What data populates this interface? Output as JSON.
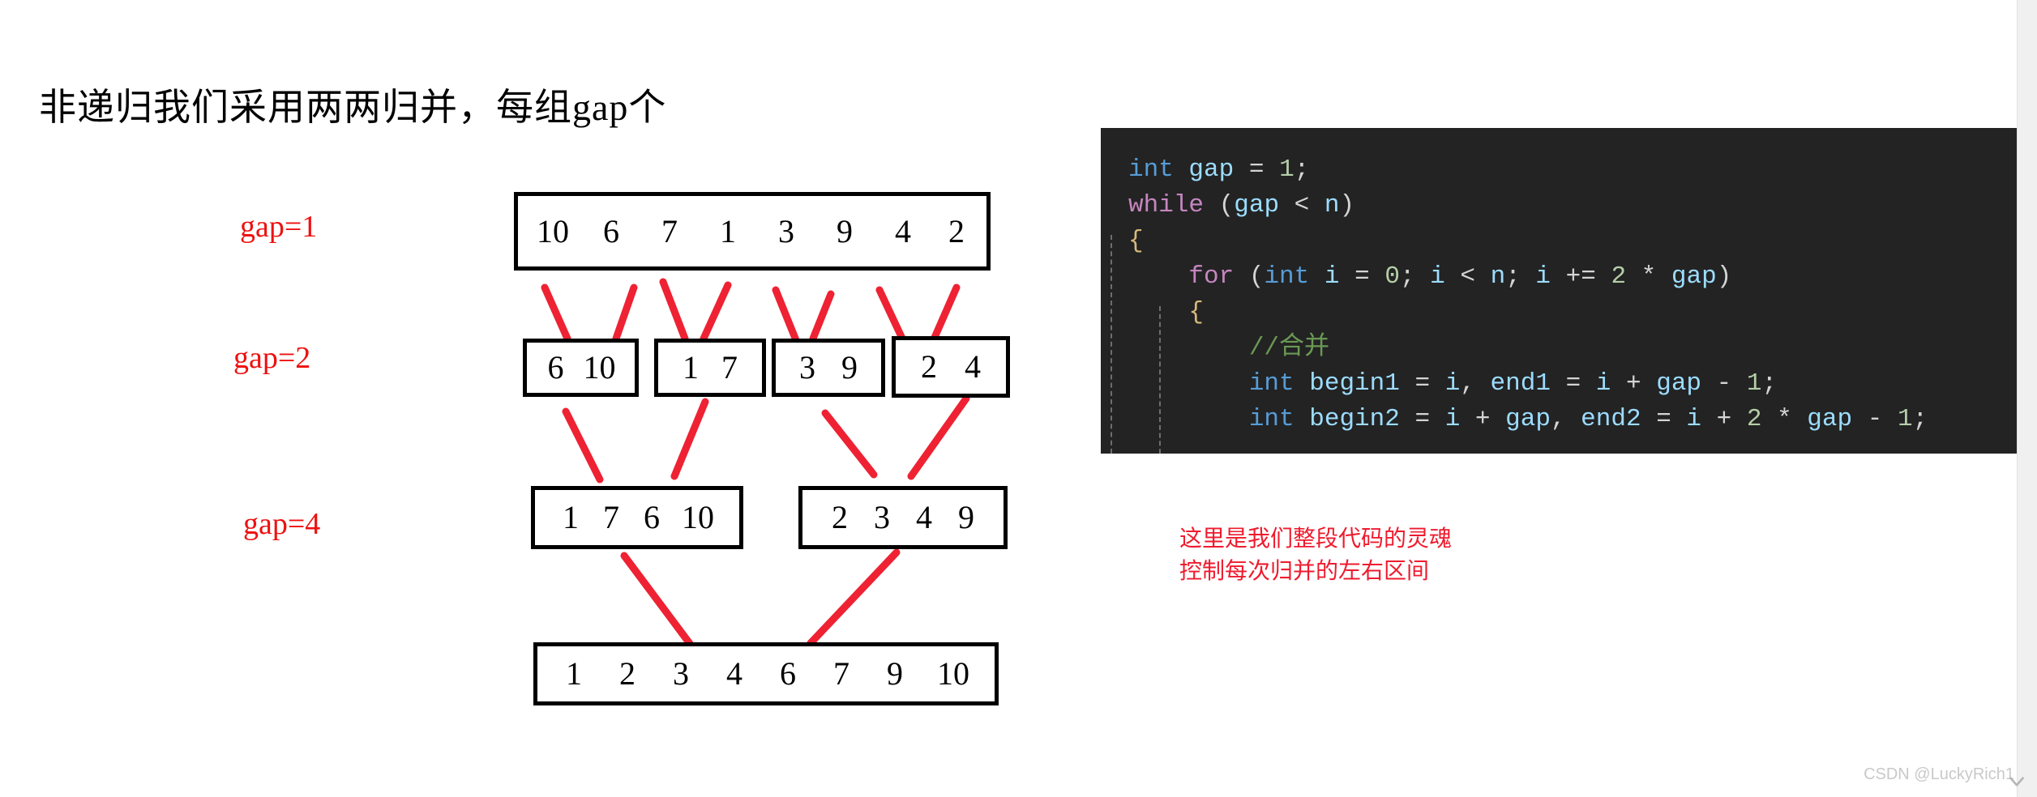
{
  "title": "非递归我们采用两两归并，每组gap个",
  "diagram": {
    "gap_labels": [
      {
        "text": "gap=1",
        "color": "#ee1111"
      },
      {
        "text": "gap=2",
        "color": "#ee1111"
      },
      {
        "text": "gap=4",
        "color": "#ee1111"
      }
    ],
    "rows": [
      {
        "level": "gap=1",
        "boxes": [
          {
            "values": [
              "10",
              "6",
              "7",
              "1",
              "3",
              "9",
              "4",
              "2"
            ]
          }
        ]
      },
      {
        "level": "gap=2",
        "boxes": [
          {
            "values": [
              "6",
              "10"
            ]
          },
          {
            "values": [
              "1",
              "7"
            ]
          },
          {
            "values": [
              "3",
              "9"
            ]
          },
          {
            "values": [
              "2",
              "4"
            ]
          }
        ]
      },
      {
        "level": "gap=4",
        "boxes": [
          {
            "values": [
              "1",
              "7",
              "6",
              "10"
            ]
          },
          {
            "values": [
              "2",
              "3",
              "4",
              "9"
            ]
          }
        ]
      },
      {
        "level": "final",
        "boxes": [
          {
            "values": [
              "1",
              "2",
              "3",
              "4",
              "6",
              "7",
              "9",
              "10"
            ]
          }
        ]
      }
    ],
    "arrow_color": "#ee2233"
  },
  "code": {
    "background": "#232323",
    "lines": [
      {
        "id": "l1",
        "text": "int gap = 1;"
      },
      {
        "id": "l2",
        "text": "while (gap < n)"
      },
      {
        "id": "l3",
        "text": "{"
      },
      {
        "id": "l4",
        "text": "    for (int i = 0; i < n; i += 2 * gap)"
      },
      {
        "id": "l5",
        "text": "    {"
      },
      {
        "id": "l6",
        "text": "        //合并"
      },
      {
        "id": "l7",
        "text": "        int begin1 = i, end1 = i + gap - 1;"
      },
      {
        "id": "l8",
        "text": "        int begin2 = i + gap, end2 = i + 2 * gap - 1;"
      }
    ]
  },
  "annotation": {
    "line1": "这里是我们整段代码的灵魂",
    "line2": "控制每次归并的左右区间",
    "color": "#ee1b2e"
  },
  "watermark": "CSDN @LuckyRich1"
}
